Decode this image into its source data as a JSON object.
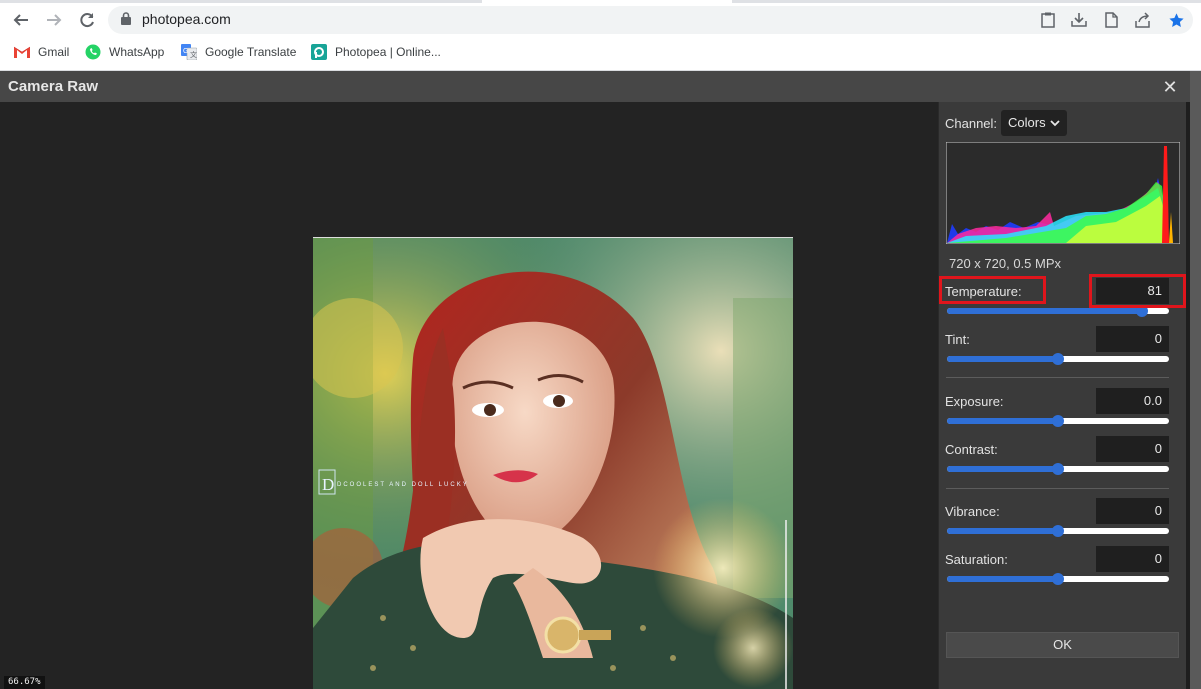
{
  "browser": {
    "url": "photopea.com",
    "bookmarks": [
      {
        "label": "Gmail",
        "icon": "gmail-icon"
      },
      {
        "label": "WhatsApp",
        "icon": "whatsapp-icon"
      },
      {
        "label": "Google Translate",
        "icon": "google-translate-icon"
      },
      {
        "label": "Photopea | Online...",
        "icon": "photopea-icon"
      }
    ]
  },
  "dialog": {
    "title": "Camera Raw",
    "zoom": "66.67%",
    "image_watermark": "DCOOLEST AND DOLL LUCKY"
  },
  "panel": {
    "channel_label": "Channel:",
    "channel_value": "Colors",
    "image_info": "720 x 720, 0.5 MPx",
    "sliders": [
      {
        "key": "temperature",
        "label": "Temperature:",
        "value": "81",
        "level": 0.88
      },
      {
        "key": "tint",
        "label": "Tint:",
        "value": "0",
        "level": 0.5
      },
      {
        "key": "exposure",
        "label": "Exposure:",
        "value": "0.0",
        "level": 0.5
      },
      {
        "key": "contrast",
        "label": "Contrast:",
        "value": "0",
        "level": 0.5
      },
      {
        "key": "vibrance",
        "label": "Vibrance:",
        "value": "0",
        "level": 0.5
      },
      {
        "key": "saturation",
        "label": "Saturation:",
        "value": "0",
        "level": 0.5
      }
    ],
    "ok_label": "OK"
  },
  "colors": {
    "accent": "#2f6fd6",
    "highlight": "#e0151c"
  }
}
